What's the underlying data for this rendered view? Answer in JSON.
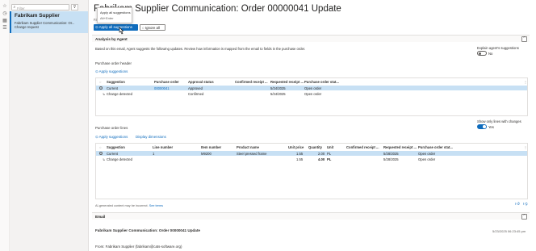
{
  "filter": {
    "placeholder": "Filter"
  },
  "record": {
    "title": "Fabrikam Supplier",
    "subtitle": "Fabrikam Supplier Communication: Or...",
    "type": "Change request"
  },
  "page": {
    "title": "Fabrikam Supplier Communication: Order 00000041 Update",
    "subtitle": "Fab"
  },
  "toolbar": {
    "apply_all_label": "Apply all suggestions",
    "ignore_all_label": "Ignore all"
  },
  "dropdown": {
    "items": [
      "Apply all suggestions",
      "Alt+Enter"
    ]
  },
  "analysis": {
    "header": "Analysis by Agent",
    "intro": "Based on this email, Agent suggests the following updates. Review how information is mapped from the email to fields in the purchase order.",
    "explain_label": "Explain agent's suggestions",
    "explain_value": "No",
    "disclaimer": "AI-generated content may be incorrect.",
    "see_terms": "See terms"
  },
  "po_header": {
    "title": "Purchase order header",
    "apply_label": "Apply suggestions",
    "columns": [
      "Suggestion",
      "Purchase order",
      "Approval status",
      "Confirmed receipt ...",
      "Requested receipt ...",
      "Purchase order stat..."
    ],
    "rows": [
      [
        "Current",
        "00000041",
        "Approved",
        "",
        "5/24/2025",
        "Open order"
      ],
      [
        "Change detected",
        "",
        "Confirmed",
        "",
        "5/24/2025",
        "Open order"
      ]
    ]
  },
  "po_lines": {
    "title": "Purchase order lines",
    "apply_label": "Apply suggestions",
    "display_dimensions_label": "Display dimensions",
    "show_only_changes_label": "Show only lines with changes",
    "show_only_changes_value": "Yes",
    "columns": [
      "Suggestion",
      "Line number",
      "Item number",
      "Product name",
      "Unit price",
      "Quantity",
      "Unit",
      "Confirmed receipt ...",
      "Requested receipt ...",
      "Purchase order stat..."
    ],
    "rows": [
      [
        "Current",
        "1",
        "M9200",
        "Steel pressed frame",
        "1.55",
        "2.00",
        "PL",
        "",
        "5/28/2025",
        "Open order"
      ],
      [
        "Change detected",
        "",
        "",
        "",
        "1.55",
        "4.00",
        "PL",
        "",
        "5/28/2025",
        "Open order"
      ]
    ]
  },
  "email": {
    "header": "Email",
    "subject": "Fabrikam Supplier Communication: Order 00000041 Update",
    "date": "5/23/2025 06:23:45 pm",
    "from": "From: Fabrikam Supplier (fabrikam@cats-software.org)"
  },
  "colors": {
    "accent": "#0f6cbd",
    "selected_row": "#c7e0f4"
  }
}
